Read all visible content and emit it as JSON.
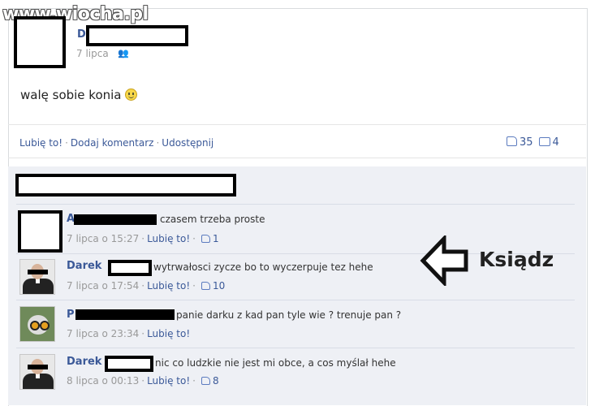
{
  "watermark": "www.wiocha.pl",
  "post": {
    "author_initial": "D",
    "date": "7 lipca",
    "text": "walę sobie konia",
    "actions": {
      "like": "Lubię to!",
      "comment": "Dodaj komentarz",
      "share": "Udostępnij"
    },
    "like_count": "35",
    "comment_count": "4"
  },
  "comments": [
    {
      "name": "A",
      "text": "czasem trzeba proste",
      "time": "7 lipca o 15:27",
      "like": "Lubię to!",
      "likes": "1"
    },
    {
      "name": "Darek",
      "text": "wytrwałosci zycze bo to wyczerpuje tez hehe",
      "time": "7 lipca o 17:54",
      "like": "Lubię to!",
      "likes": "10"
    },
    {
      "name": "P",
      "text": "panie darku z kad pan tyle wie ? trenuje pan ?",
      "time": "7 lipca o 23:34",
      "like": "Lubię to!",
      "likes": ""
    },
    {
      "name": "Darek",
      "text": "nic co ludzkie nie jest mi obce, a cos myślał hehe",
      "time": "8 lipca o 00:13",
      "like": "Lubię to!",
      "likes": "8"
    }
  ],
  "annotation": {
    "label": "Ksiądz",
    "icon": "arrow-left-icon"
  },
  "colors": {
    "link": "#3b5998",
    "comments_bg": "#eef0f5",
    "censor": "#000000"
  }
}
